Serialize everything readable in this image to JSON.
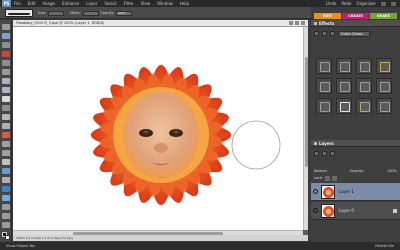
{
  "app": {
    "logo": "PS",
    "menus": [
      "File",
      "Edit",
      "Image",
      "Enhance",
      "Layer",
      "Select",
      "Filter",
      "View",
      "Window",
      "Help"
    ],
    "window_controls": [
      "Undo",
      "Redo",
      "Organizer"
    ]
  },
  "options": {
    "size_label": "Size:",
    "size_value": "",
    "mode_label": "Mode:",
    "mode_value": "",
    "opacity_label": "Opacity:",
    "opacity_value": "100%"
  },
  "mode_tabs": {
    "edit": "EDIT",
    "create": "CREATE",
    "share": "SHARE"
  },
  "document": {
    "title": "Flowbaby_0010 R_3.psd @ 100% (Layer 1, RGB/8)",
    "status": "100%    1.5 inches x 1.5 inches (72 ppi)"
  },
  "effects_panel": {
    "title": "Effects",
    "category": "Outer Glows",
    "apply_label": "Apply",
    "thumbs": [
      "plain",
      "plain",
      "plain",
      "gold",
      "plain",
      "plain",
      "plain",
      "plain",
      "plain",
      "white",
      "olive",
      "plain"
    ]
  },
  "layers_panel": {
    "title": "Layers",
    "blend_mode": "Normal",
    "opacity_label": "Opacity:",
    "opacity_value": "100%",
    "lock_label": "Lock:",
    "layers": [
      {
        "name": "Layer 1",
        "active": true
      },
      {
        "name": "Layer 0",
        "active": false
      }
    ]
  },
  "bottom": {
    "left": "Show Project Bin",
    "right": "Palette Bin"
  },
  "colors": {
    "petal": "#ea4b1e",
    "petal_light": "#f8a23a",
    "skin": "#e8b088",
    "edit_tab": "#e88f1f",
    "create_tab": "#b9246e",
    "share_tab": "#74a731"
  }
}
